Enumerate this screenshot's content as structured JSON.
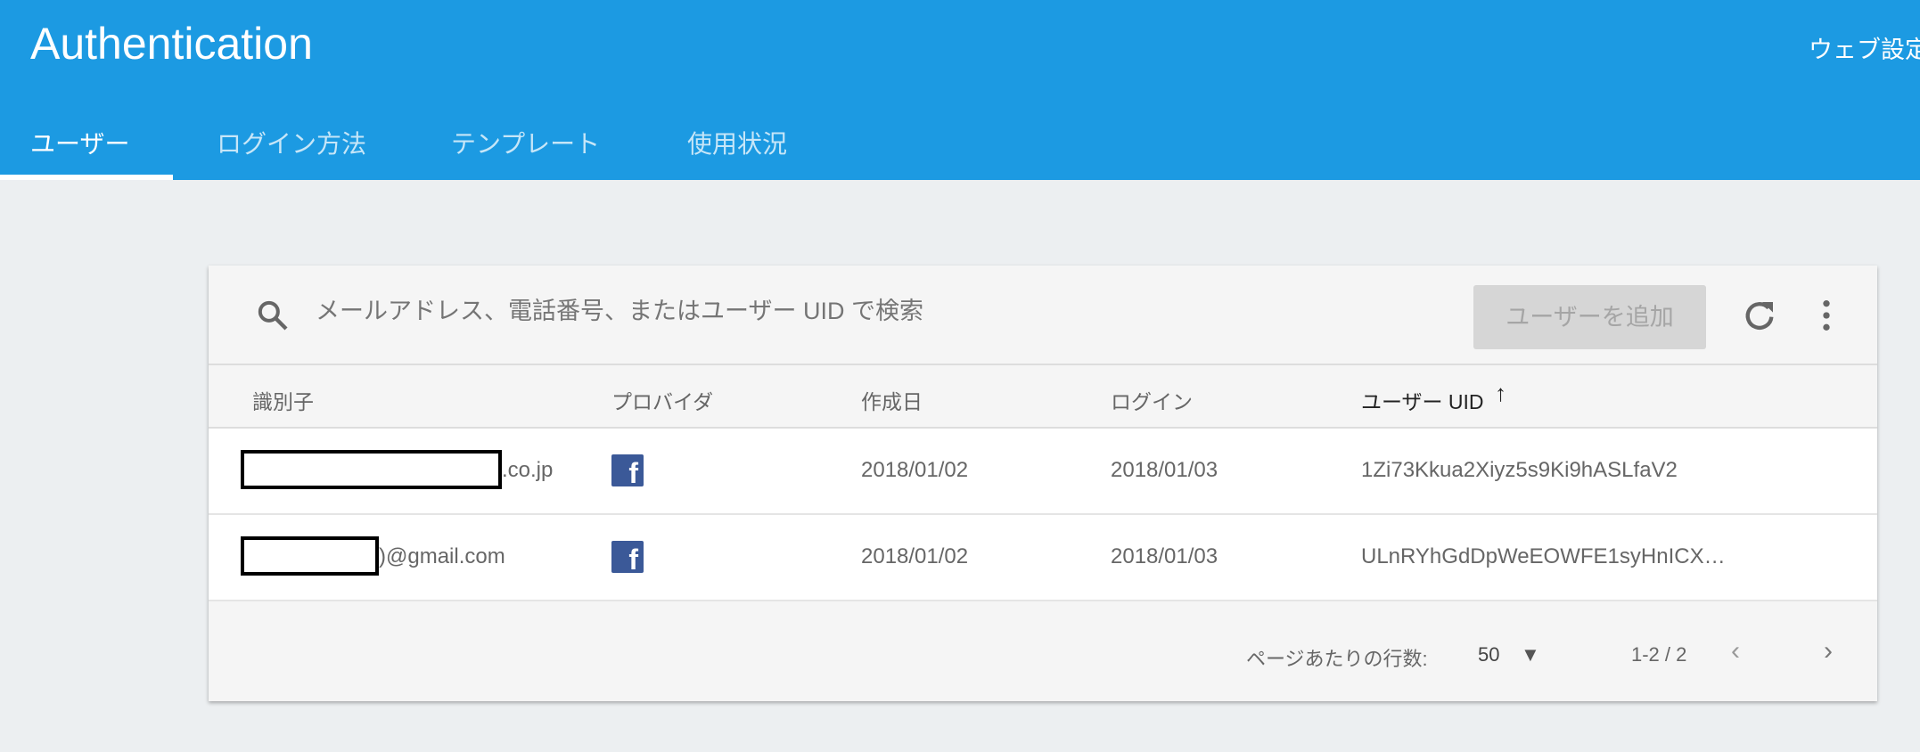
{
  "header": {
    "title": "Authentication",
    "web_setup": "ウェブ設定"
  },
  "tabs": [
    {
      "label": "ユーザー"
    },
    {
      "label": "ログイン方法"
    },
    {
      "label": "テンプレート"
    },
    {
      "label": "使用状況"
    }
  ],
  "toolbar": {
    "search_placeholder": "メールアドレス、電話番号、またはユーザー UID で検索",
    "add_user": "ユーザーを追加"
  },
  "columns": [
    "識別子",
    "プロバイダ",
    "作成日",
    "ログイン",
    "ユーザー UID"
  ],
  "rows": [
    {
      "identifier_suffix": ".co.jp",
      "provider": "facebook",
      "created": "2018/01/02",
      "login": "2018/01/03",
      "uid": "1Zi73Kkua2Xiyz5s9Ki9hASLfaV2"
    },
    {
      "identifier_suffix": ")@gmail.com",
      "provider": "facebook",
      "created": "2018/01/02",
      "login": "2018/01/03",
      "uid": "ULnRYhGdDpWeEOWFE1syHnICX…"
    }
  ],
  "footer": {
    "rows_per_page_label": "ページあたりの行数:",
    "rows_per_page": "50",
    "range": "1-2 / 2"
  },
  "colors": {
    "header": "#1c9ae2",
    "facebook": "#3b5998"
  }
}
